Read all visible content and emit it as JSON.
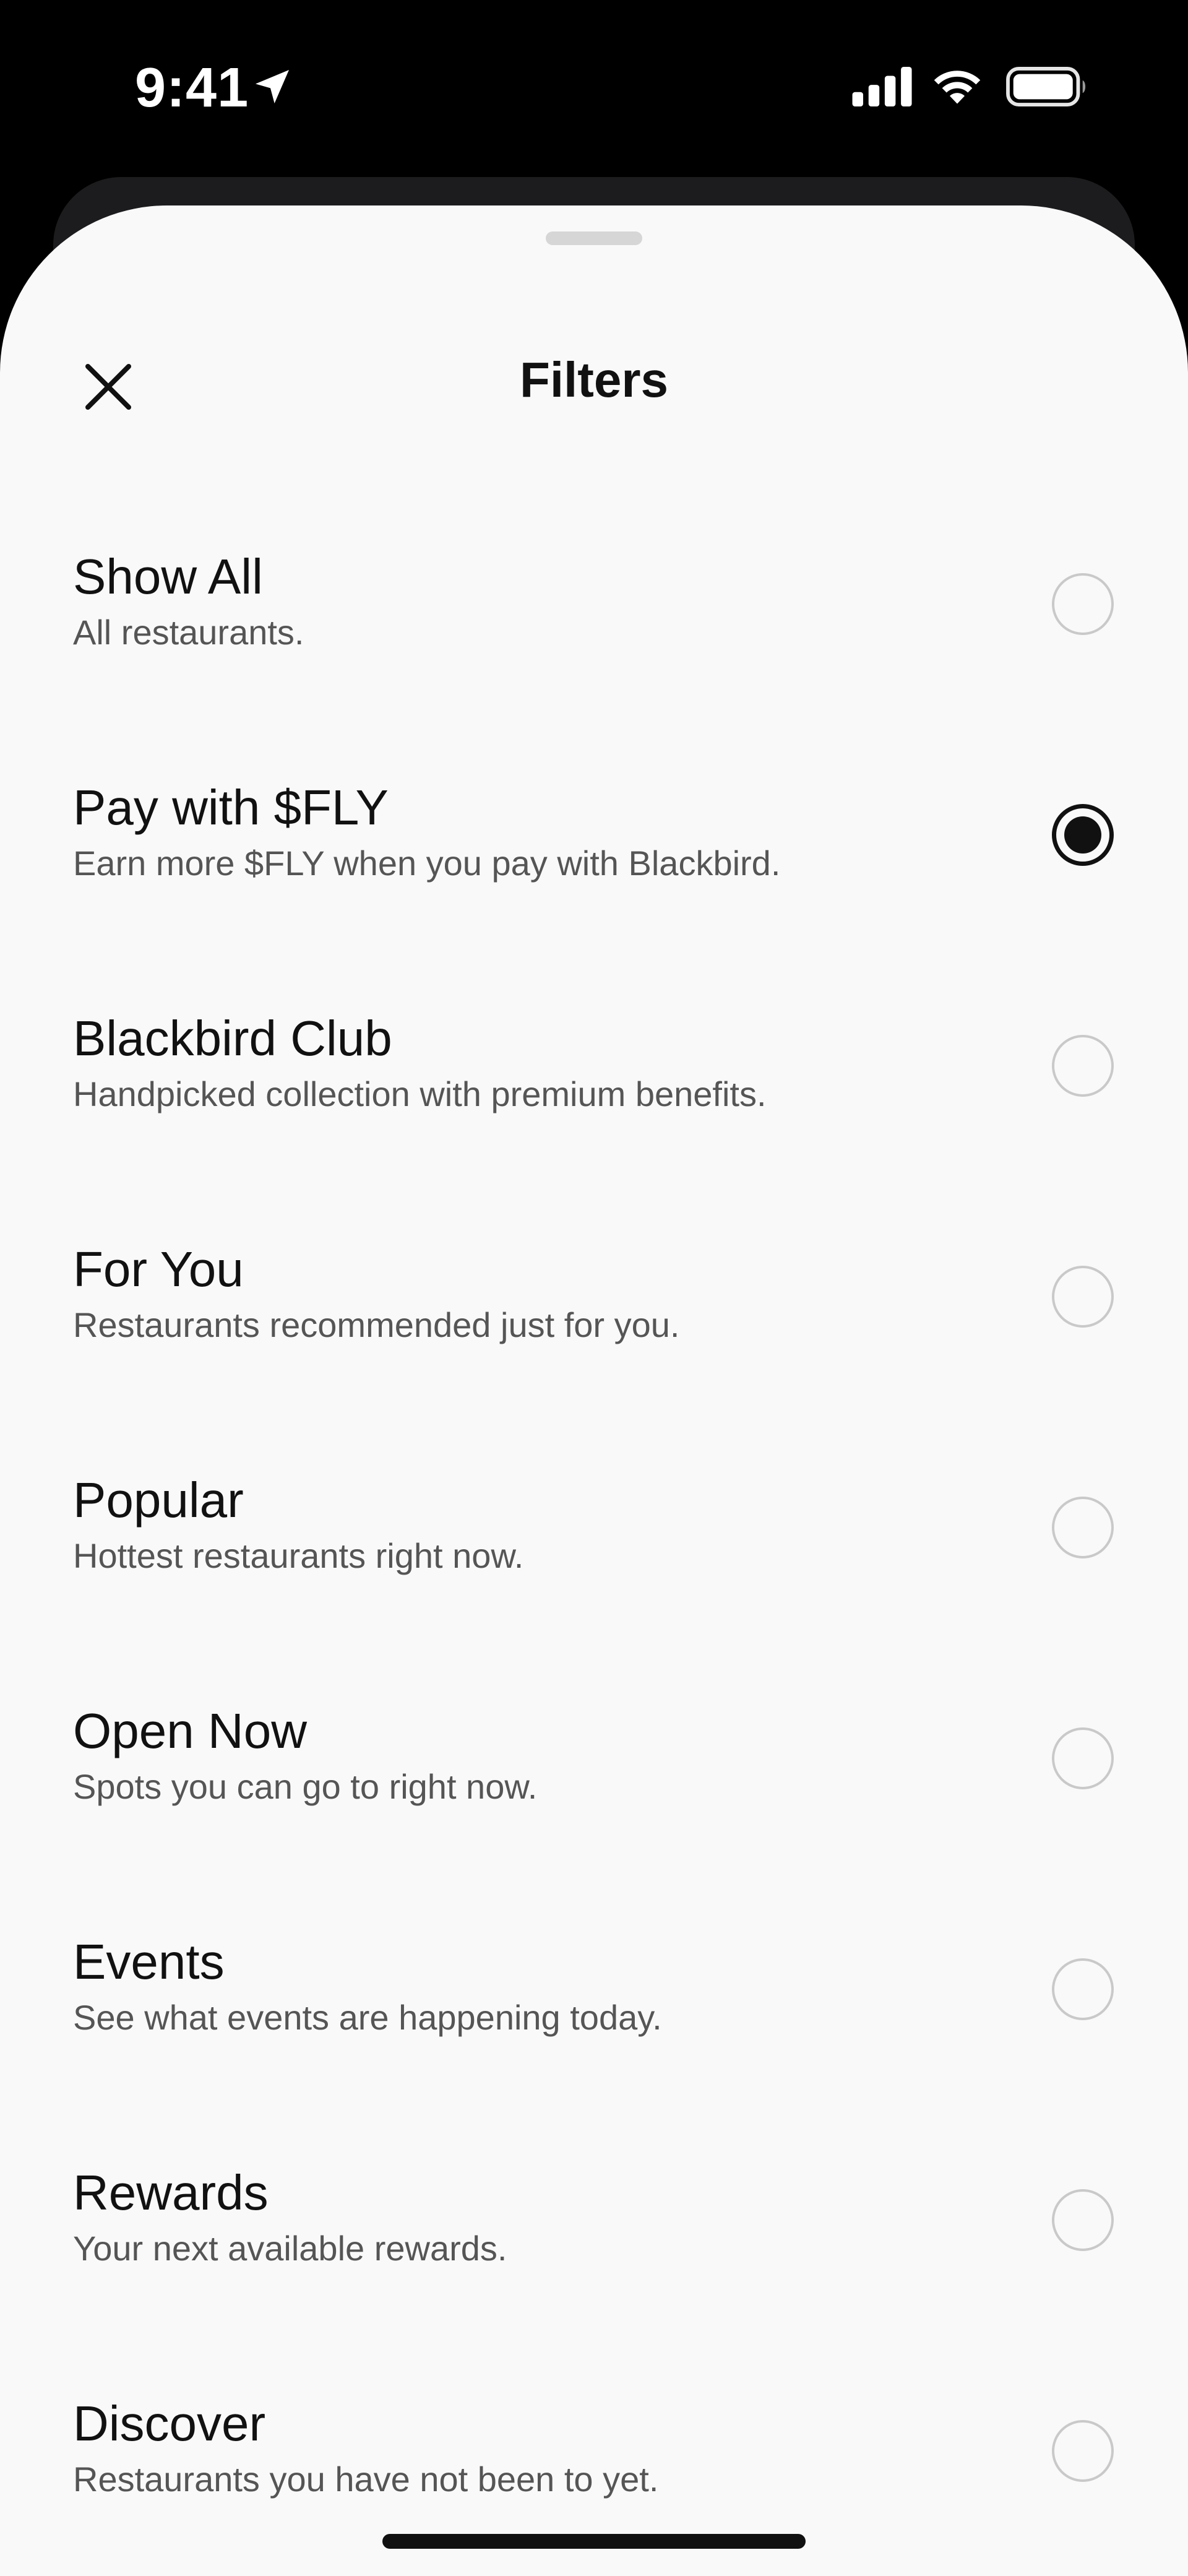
{
  "status_bar": {
    "time": "9:41"
  },
  "header": {
    "title": "Filters",
    "close_icon": "close-icon"
  },
  "filters": [
    {
      "title": "Show All",
      "subtitle": "All restaurants.",
      "selected": false
    },
    {
      "title": "Pay with $FLY",
      "subtitle": "Earn more $FLY when you pay with Blackbird.",
      "selected": true
    },
    {
      "title": "Blackbird Club",
      "subtitle": "Handpicked collection with premium benefits.",
      "selected": false
    },
    {
      "title": "For You",
      "subtitle": "Restaurants recommended just for you.",
      "selected": false
    },
    {
      "title": "Popular",
      "subtitle": "Hottest restaurants right now.",
      "selected": false
    },
    {
      "title": "Open Now",
      "subtitle": "Spots you can go to right now.",
      "selected": false
    },
    {
      "title": "Events",
      "subtitle": "See what events are happening today.",
      "selected": false
    },
    {
      "title": "Rewards",
      "subtitle": "Your next available rewards.",
      "selected": false
    },
    {
      "title": "Discover",
      "subtitle": "Restaurants you have not been to yet.",
      "selected": false
    }
  ],
  "colors": {
    "sheet_background": "#f9f9f9",
    "text_primary": "#111111",
    "text_secondary": "#555555",
    "radio_border": "#c9c9c9"
  }
}
